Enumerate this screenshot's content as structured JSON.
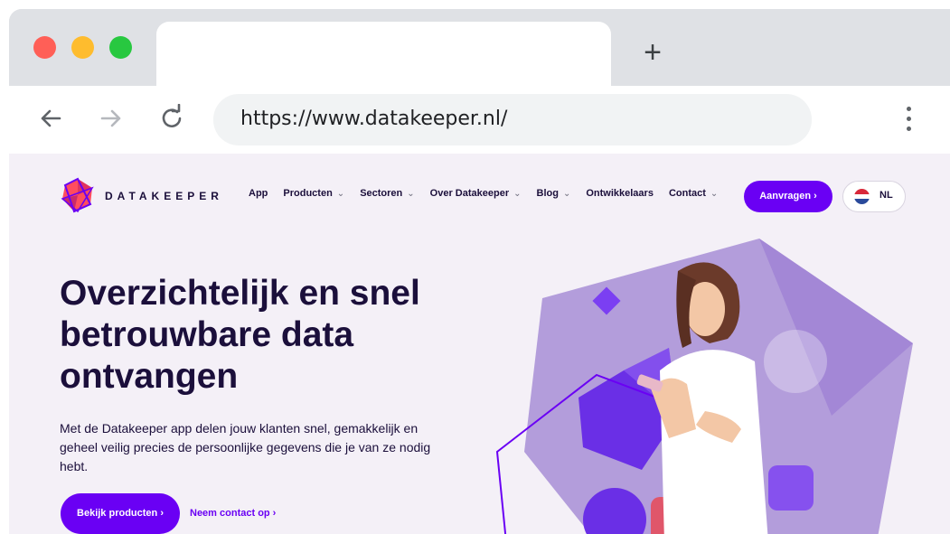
{
  "browser": {
    "url": "https://www.datakeeper.nl/",
    "new_tab_symbol": "+",
    "icons": [
      "back-arrow-icon",
      "forward-arrow-icon",
      "reload-icon",
      "more-menu-icon"
    ]
  },
  "site": {
    "brand": "DATAKEEPER",
    "nav": {
      "items": [
        {
          "label": "App",
          "chevron": ""
        },
        {
          "label": "Producten",
          "chevron": "⌄"
        },
        {
          "label": "Sectoren",
          "chevron": "⌄"
        },
        {
          "label": "Over Datakeeper",
          "chevron": "⌄"
        },
        {
          "label": "Blog",
          "chevron": "⌄"
        },
        {
          "label": "Ontwikkelaars",
          "chevron": ""
        },
        {
          "label": "Contact",
          "chevron": "⌄"
        }
      ],
      "cta": "Aanvragen ›",
      "language": "NL"
    },
    "hero": {
      "title": "Overzichtelijk en snel betrouwbare data ontvangen",
      "text": "Met de Datakeeper app delen jouw klanten snel, gemakkelijk en geheel veilig precies de persoonlijke gegevens die je van ze nodig hebt.",
      "primary_button": "Bekijk producten ›",
      "secondary_link": "Neem contact op ›"
    },
    "colors": {
      "accent": "#6a00f4",
      "text": "#1b0f3b",
      "background": "#f4f0f7"
    }
  }
}
